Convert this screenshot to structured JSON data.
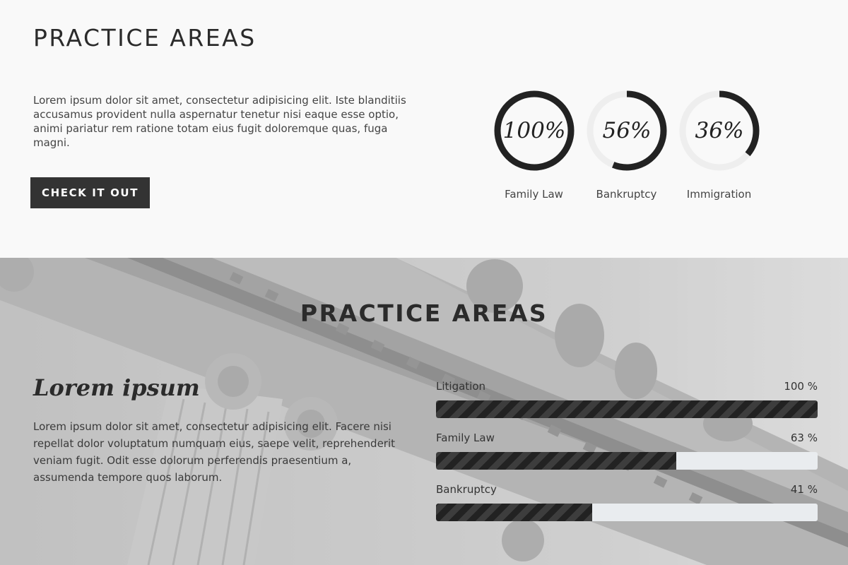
{
  "top": {
    "title": "PRACTICE AREAS",
    "text": "Lorem ipsum dolor sit amet, consectetur adipisicing elit. Iste blanditiis accusamus provident nulla aspernatur tenetur nisi eaque esse optio, animi pariatur rem ratione totam eius fugit doloremque quas, fuga magni.",
    "button_label": "CHECK IT OUT",
    "circles": [
      {
        "label": "Family Law",
        "percent_text": "100%",
        "value": 100
      },
      {
        "label": "Bankruptcy",
        "percent_text": "56%",
        "value": 56
      },
      {
        "label": "Immigration",
        "percent_text": "36%",
        "value": 36
      }
    ]
  },
  "bottom": {
    "title": "PRACTICE AREAS",
    "heading": "Lorem ipsum",
    "text": "Lorem ipsum dolor sit amet, consectetur adipisicing elit. Facere nisi repellat dolor voluptatum numquam eius, saepe velit, reprehenderit veniam fugit. Odit esse dolorum perferendis praesentium a, assumenda tempore quos laborum.",
    "bars": [
      {
        "label": "Litigation",
        "value_text": "100 %",
        "value": 100
      },
      {
        "label": "Family Law",
        "value_text": "63 %",
        "value": 63
      },
      {
        "label": "Bankruptcy",
        "value_text": "41 %",
        "value": 41
      }
    ]
  },
  "colors": {
    "ring": "#222222",
    "ring_track": "#eeeeee",
    "button": "#333333",
    "bar_fill": "#222222",
    "bar_track": "#e9ecef"
  }
}
